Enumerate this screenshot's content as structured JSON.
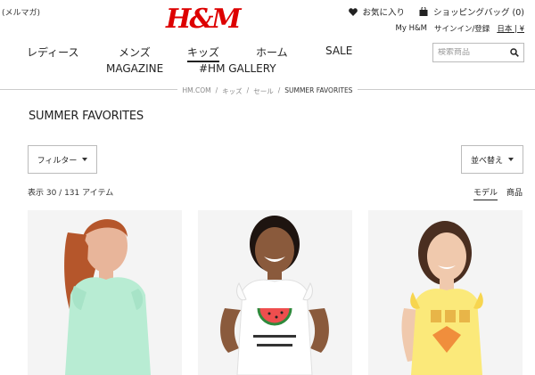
{
  "header": {
    "top_left": "(メルマガ)",
    "logo": "H&M",
    "favorites_label": "お気に入り",
    "cart_label": "ショッピングバッグ (0)",
    "my_hm": "My H&M",
    "sign_in": "サインイン/登録",
    "locale": "日本 | ¥"
  },
  "nav": {
    "ladies": "レディース",
    "mens": "メンズ",
    "kids": "キッズ",
    "home": "ホーム",
    "sale": "SALE",
    "magazine": "MAGAZINE",
    "gallery": "#HM GALLERY"
  },
  "search": {
    "placeholder": "検索商品"
  },
  "breadcrumb": {
    "home": "HM.COM",
    "kids": "キッズ",
    "sale": "セール",
    "current": "SUMMER FAVORITES",
    "sep": "/"
  },
  "page": {
    "title": "SUMMER FAVORITES",
    "filter_label": "フィルター",
    "sort_label": "並べ替え",
    "count": "表示 30 / 131 アイテム",
    "view_model": "モデル",
    "view_product": "商品"
  },
  "products": [
    {
      "desc": "girl in mint ruffle top"
    },
    {
      "desc": "girl in white tank with watermelon print"
    },
    {
      "desc": "girl in yellow ruffle tank with print"
    }
  ],
  "colors": {
    "logo": "#dd0000",
    "text": "#222222",
    "border": "#bbbbbb"
  }
}
